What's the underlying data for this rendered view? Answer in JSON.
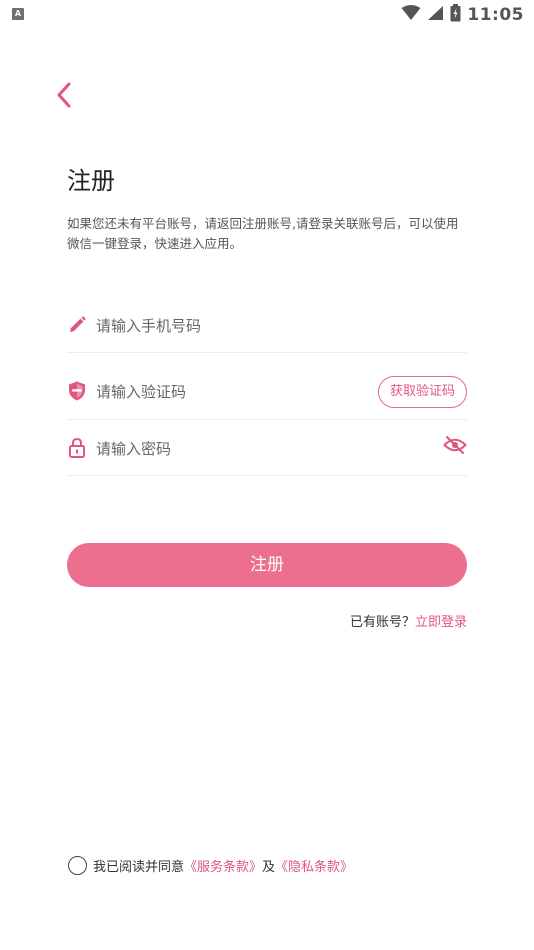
{
  "status_bar": {
    "left_badge": "A",
    "time": "11:05",
    "icons": [
      "wifi-icon",
      "signal-icon",
      "battery-icon"
    ]
  },
  "back": {
    "icon": "chevron-left-icon"
  },
  "title": "注册",
  "description": "如果您还未有平台账号，请返回注册账号,请登录关联账号后，可以使用微信一键登录，快速进入应用。",
  "form": {
    "phone": {
      "placeholder": "请输入手机号码",
      "icon": "pencil-icon"
    },
    "code": {
      "placeholder": "请输入验证码",
      "icon": "shield-icon",
      "button_label": "获取验证码"
    },
    "password": {
      "placeholder": "请输入密码",
      "icon": "lock-icon",
      "toggle_icon": "eye-off-icon"
    }
  },
  "register_button": "注册",
  "login_prompt": {
    "text": "已有账号？",
    "link": "立即登录"
  },
  "agreement": {
    "text": "我已阅读并同意",
    "service_terms": "《服务条款》",
    "and": "及",
    "privacy_terms": "《隐私条款》"
  },
  "colors": {
    "accent": "#e0577d",
    "button": "#ec6f8f",
    "divider": "#ececec"
  }
}
